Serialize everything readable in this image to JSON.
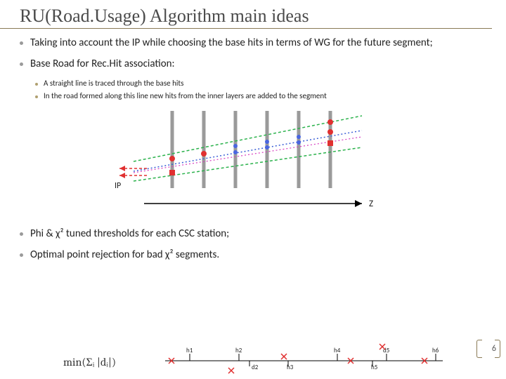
{
  "title": "RU(Road.Usage) Algorithm main ideas",
  "bullets": [
    {
      "level": 1,
      "text": "Taking into account the IP while choosing the base hits in terms of WG for the future segment;"
    },
    {
      "level": 1,
      "text": "Base Road for Rec.Hit association:"
    },
    {
      "level": 2,
      "text": "A straight line is traced through the base hits"
    },
    {
      "level": 2,
      "text": "In the road formed along this line new hits from the inner layers are added to the segment"
    },
    {
      "level": 1,
      "text": "Phi & χ² tuned thresholds for each CSC station;"
    },
    {
      "level": 1,
      "text": "Optimal point rejection for bad χ² segments."
    }
  ],
  "diagram": {
    "ip_label": "IP",
    "z_label": "Z",
    "layers": 6
  },
  "formula": "min(Σᵢ |dᵢ|)",
  "hit_labels": [
    "h1",
    "h2",
    "h4",
    "d5",
    "h6",
    "d2",
    "h3",
    "h5"
  ],
  "page": "6"
}
